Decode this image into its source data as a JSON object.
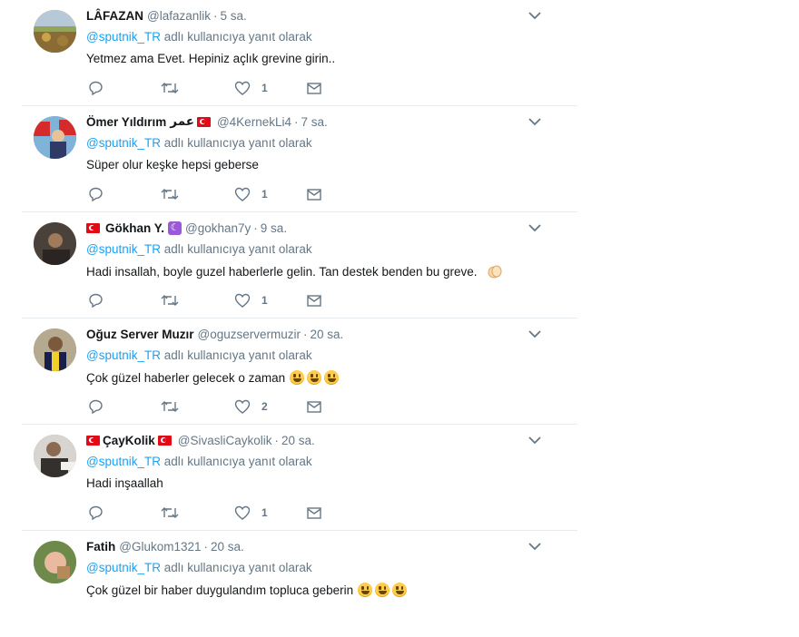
{
  "reply_prefix": "adlı kullanıcıya yanıt olarak",
  "mention": "@sputnik_TR",
  "icons": {
    "reply": "reply-icon",
    "retweet": "retweet-icon",
    "like": "heart-icon",
    "dm": "mail-icon",
    "more": "chevron-down-icon"
  },
  "tweets": [
    {
      "name": "LÂFAZAN",
      "handle": "@lafazanlik",
      "time": "5 sa.",
      "text": "Yetmez ama Evet. Hepiniz açlık grevine girin..",
      "likes": "1",
      "avatar_color": "#7d8f3b"
    },
    {
      "name": "Ömer Yıldırım",
      "name_suffix": "عمر",
      "handle": "@4KernekLi4",
      "time": "7 sa.",
      "text": "Süper olur keşke hepsi geberse",
      "likes": "1",
      "avatar_color": "#c0392b"
    },
    {
      "name": "Gökhan Y.",
      "handle": "@gokhan7y",
      "time": "9 sa.",
      "text": "Hadi insallah, boyle guzel haberlerle gelin. Tan destek benden bu greve.",
      "likes": "1",
      "avatar_color": "#3b3630"
    },
    {
      "name": "Oğuz Server Muzır",
      "handle": "@oguzservermuzir",
      "time": "20 sa.",
      "text": "Çok güzel haberler gelecek o zaman",
      "likes": "2",
      "avatar_color": "#7a6a45"
    },
    {
      "name": "ÇayKolik",
      "handle": "@SivasliCaykolik",
      "time": "20 sa.",
      "text": "Hadi inşaallah",
      "likes": "1",
      "avatar_color": "#8e8a85"
    },
    {
      "name": "Fatih",
      "handle": "@Glukom1321",
      "time": "20 sa.",
      "text": "Çok güzel bir haber duygulandım topluca geberin",
      "likes": "",
      "avatar_color": "#5b7a3a"
    }
  ]
}
